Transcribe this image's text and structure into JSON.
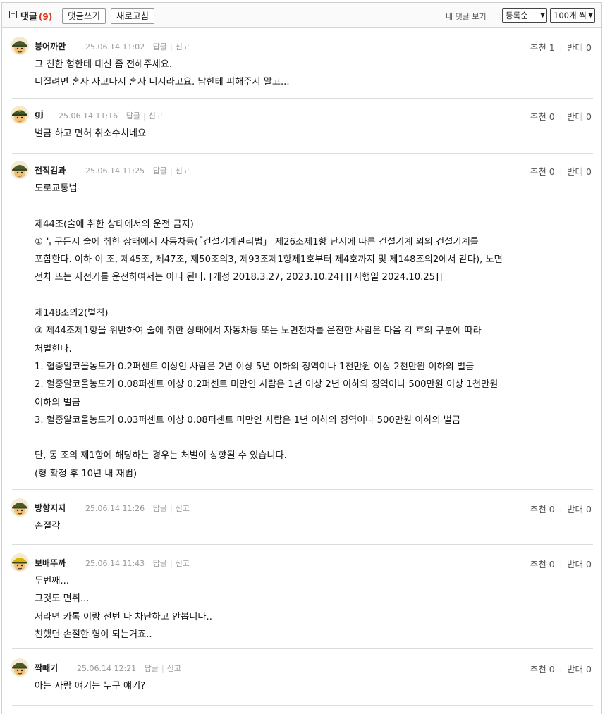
{
  "header": {
    "title": "댓글",
    "count": "(9)",
    "write_label": "댓글쓰기",
    "refresh_label": "새로고침",
    "my_comments_label": "내 댓글 보기",
    "sort_value": "등록순",
    "per_page_value": "100개 씩"
  },
  "comments": [
    {
      "author": "붕어까만",
      "date": "25.06.14 11:02",
      "reply": "답글",
      "report": "신고",
      "up_label": "추천",
      "up": "1",
      "down_label": "반대",
      "down": "0",
      "avatar": "soldier-helmet-avatar",
      "body": "그 친한 형한테 대신 좀 전해주세요.\n디질려면 혼자 사고나서 혼자 디지라고요. 남한테 피해주지 말고..."
    },
    {
      "author": "gj",
      "date": "25.06.14 11:16",
      "reply": "답글",
      "report": "신고",
      "up_label": "추천",
      "up": "0",
      "down_label": "반대",
      "down": "0",
      "avatar": "officer-cap-avatar",
      "body": "벌금 하고 면허 취소수치네요"
    },
    {
      "author": "전직김과",
      "date": "25.06.14 11:25",
      "reply": "답글",
      "report": "신고",
      "up_label": "추천",
      "up": "0",
      "down_label": "반대",
      "down": "0",
      "avatar": "soldier-helmet-avatar",
      "body": "도로교통법\n\n제44조(술에 취한 상태에서의 운전 금지)\n① 누구든지 술에 취한 상태에서 자동차등(「건설기계관리법」 제26조제1항 단서에 따른 건설기계 외의 건설기계를\n포함한다. 이하 이 조, 제45조, 제47조, 제50조의3, 제93조제1항제1호부터 제4호까지 및 제148조의2에서 같다), 노면\n전차 또는 자전거를 운전하여서는 아니 된다. [개정 2018.3.27, 2023.10.24] [[시행일 2024.10.25]]\n\n제148조의2(벌칙)\n③ 제44조제1항을 위반하여 술에 취한 상태에서 자동차등 또는 노면전차를 운전한 사람은 다음 각 호의 구분에 따라\n처벌한다.\n1. 혈중알코올농도가 0.2퍼센트 이상인 사람은 2년 이상 5년 이하의 징역이나 1천만원 이상 2천만원 이하의 벌금\n2. 혈중알코올농도가 0.08퍼센트 이상 0.2퍼센트 미만인 사람은 1년 이상 2년 이하의 징역이나 500만원 이상 1천만원\n이하의 벌금\n3. 혈중알코올농도가 0.03퍼센트 이상 0.08퍼센트 미만인 사람은 1년 이하의 징역이나 500만원 이하의 벌금\n\n단, 동 조의 제1항에 해당하는 경우는 처벌이 상향될 수 있습니다.\n(형 확정 후 10년 내 재범)"
    },
    {
      "author": "방향지지",
      "date": "25.06.14 11:26",
      "reply": "답글",
      "report": "신고",
      "up_label": "추천",
      "up": "0",
      "down_label": "반대",
      "down": "0",
      "avatar": "soldier-helmet-avatar",
      "body": "손절각"
    },
    {
      "author": "보배뚜까",
      "date": "25.06.14 11:43",
      "reply": "답글",
      "report": "신고",
      "up_label": "추천",
      "up": "0",
      "down_label": "반대",
      "down": "0",
      "avatar": "yellow-helmet-avatar",
      "body": "두번째...\n그것도 면취...\n저라면 카톡 이랑 전번 다 차단하고 안봅니다..\n친했던 손절한 형이 되는거죠.."
    },
    {
      "author": "짝빼기",
      "date": "25.06.14 12:21",
      "reply": "답글",
      "report": "신고",
      "up_label": "추천",
      "up": "0",
      "down_label": "반대",
      "down": "0",
      "avatar": "soldier-helmet-avatar",
      "body": "아는 사람 얘기는 누구 얘기?"
    }
  ],
  "colors": {
    "count": "#d9331c",
    "divider": "#dcdcdc",
    "helmet_green": "#4a5a2a",
    "helmet_yellow": "#d8b400",
    "skin": "#f2c27a"
  }
}
